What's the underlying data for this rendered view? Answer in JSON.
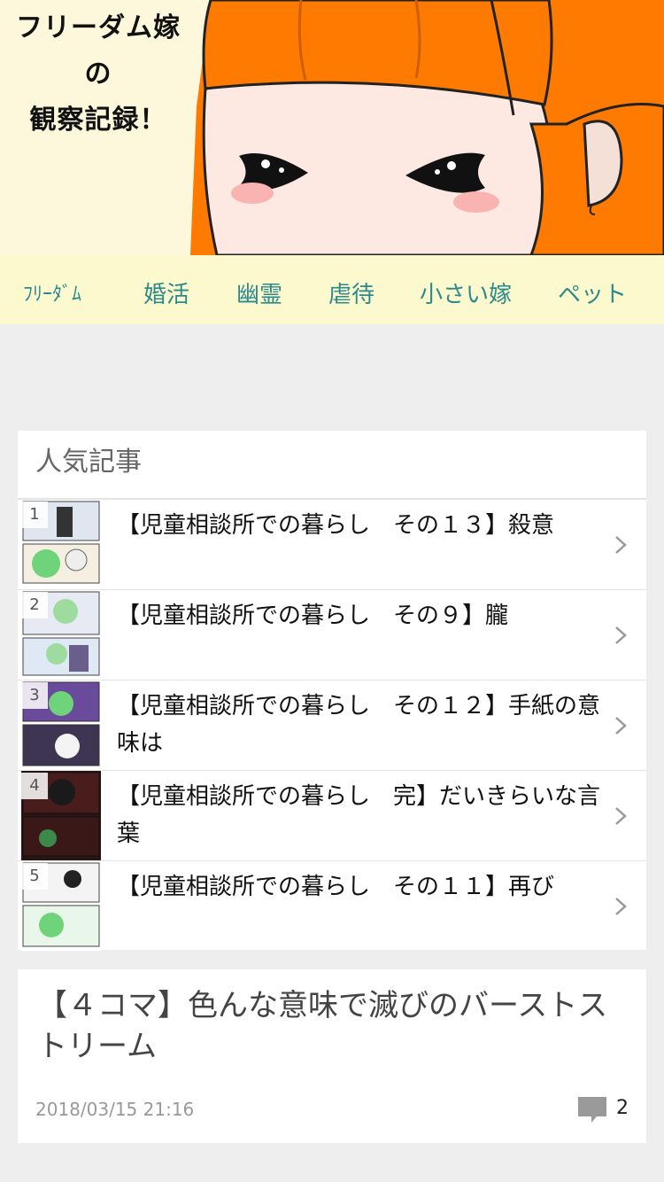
{
  "header": {
    "title_lines": [
      "フリーダム嫁",
      "の",
      "観察記録！"
    ]
  },
  "nav": {
    "items": [
      "ﾌﾘｰﾀﾞﾑ",
      "婚活",
      "幽霊",
      "虐待",
      "小さい嫁",
      "ペット"
    ]
  },
  "popular": {
    "heading": "人気記事",
    "items": [
      {
        "rank": "1",
        "title": "【児童相談所での暮らし　その１３】殺意"
      },
      {
        "rank": "2",
        "title": "【児童相談所での暮らし　その９】朧"
      },
      {
        "rank": "3",
        "title": "【児童相談所での暮らし　その１２】手紙の意味は"
      },
      {
        "rank": "4",
        "title": "【児童相談所での暮らし　完】だいきらいな言葉"
      },
      {
        "rank": "5",
        "title": "【児童相談所での暮らし　その１１】再び"
      }
    ]
  },
  "article": {
    "title": "【４コマ】色んな意味で滅びのバーストストリーム",
    "date": "2018/03/15 21:16",
    "comment_count": "2"
  },
  "colors": {
    "header_bg": "#fdf7dc",
    "hair": "#ff7a00",
    "nav_bg": "#fdf9cf",
    "nav_text": "#2b8a8c",
    "page_bg": "#eeeeee"
  }
}
